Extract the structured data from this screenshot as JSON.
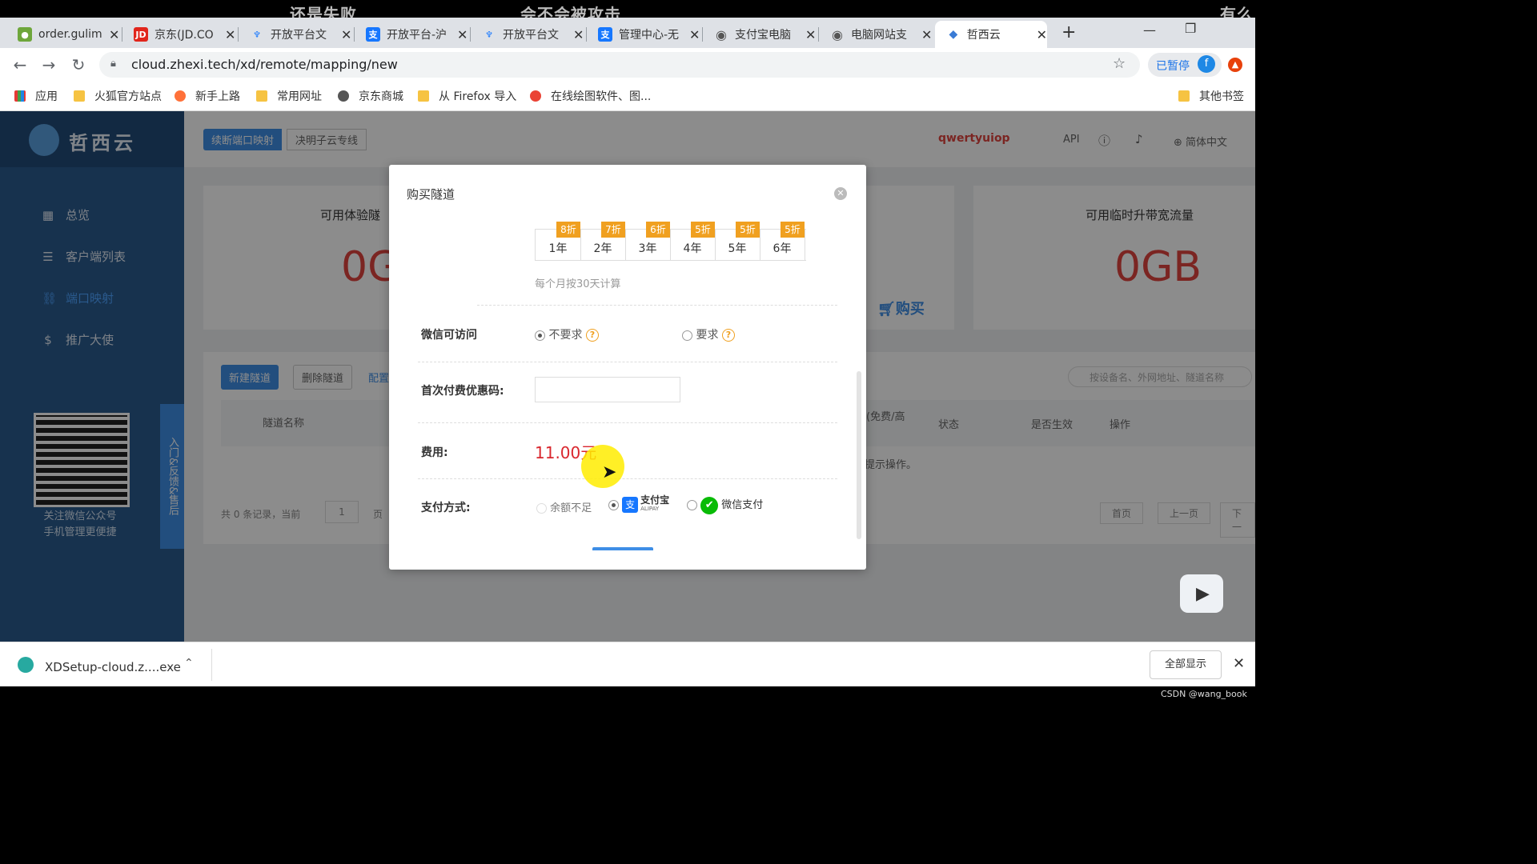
{
  "overlay": {
    "texts": [
      "还是失败",
      "会不会被攻击",
      "有么"
    ]
  },
  "tabs": [
    {
      "label": "order.gulim",
      "icon": "leaf-icon",
      "color": "#6ea63b"
    },
    {
      "label": "京东(JD.CO",
      "icon": "jd-icon",
      "color": "#e1251b"
    },
    {
      "label": "开放平台文",
      "icon": "ant-icon",
      "color": "#1677ff"
    },
    {
      "label": "开放平台-沪",
      "icon": "alipay-icon",
      "color": "#1677ff"
    },
    {
      "label": "开放平台文",
      "icon": "ant-icon",
      "color": "#1677ff"
    },
    {
      "label": "管理中心-无",
      "icon": "alipay-icon",
      "color": "#1677ff"
    },
    {
      "label": "支付宝电脑",
      "icon": "globe-icon",
      "color": "#555"
    },
    {
      "label": "电脑网站支",
      "icon": "globe-icon",
      "color": "#555"
    },
    {
      "label": "哲西云",
      "icon": "zhexi-icon",
      "color": "#3a7bd5"
    }
  ],
  "address": {
    "url": "cloud.zhexi.tech/xd/remote/mapping/new",
    "paused_label": "已暂停",
    "avatar_letter": "f"
  },
  "bookmarks": [
    {
      "label": "应用"
    },
    {
      "label": "火狐官方站点"
    },
    {
      "label": "新手上路"
    },
    {
      "label": "常用网址"
    },
    {
      "label": "京东商城"
    },
    {
      "label": "从 Firefox 导入"
    },
    {
      "label": "在线绘图软件、图..."
    }
  ],
  "bookmarks_other": "其他书签",
  "app": {
    "logo_text": "哲西云",
    "header_tabs": [
      "续断端口映射",
      "决明子云专线"
    ],
    "username": "qwertyuiop",
    "api_label": "API",
    "lang_label": "简体中文",
    "nav": [
      {
        "label": "总览",
        "icon": "grid-icon"
      },
      {
        "label": "客户端列表",
        "icon": "server-icon"
      },
      {
        "label": "端口映射",
        "icon": "link-icon"
      },
      {
        "label": "推广大使",
        "icon": "dollar-icon"
      }
    ],
    "qr_caption": [
      "关注微信公众号",
      "手机管理更便捷"
    ],
    "feedback_tab": "入门&反馈&售后",
    "card1": {
      "title": "可用体验隧",
      "value": "0G"
    },
    "card3": {
      "title": "可用临时升带宽流量",
      "value": "0GB"
    },
    "buy_label": "购买",
    "buttons": {
      "new": "新建隧道",
      "delete": "删除隧道",
      "config": "配置"
    },
    "search_placeholder": "按设备名、外网地址、隧道名称",
    "columns": [
      "隧道名称",
      "(免费/高",
      "状态",
      "是否生效",
      "操作"
    ],
    "empty_hint": "提示操作。",
    "pager": {
      "summary": "共 0 条记录，当前",
      "page": "1",
      "page_suffix": "页",
      "first": "首页",
      "prev": "上一页",
      "next": "下一"
    }
  },
  "modal": {
    "title": "购买隧道",
    "years": [
      {
        "label": "1年",
        "discount": "8折"
      },
      {
        "label": "2年",
        "discount": "7折"
      },
      {
        "label": "3年",
        "discount": "6折"
      },
      {
        "label": "4年",
        "discount": "5折"
      },
      {
        "label": "5年",
        "discount": "5折"
      },
      {
        "label": "6年",
        "discount": "5折"
      }
    ],
    "month_note": "每个月按30天计算",
    "wechat_label": "微信可访问",
    "wechat_options": [
      "不要求",
      "要求"
    ],
    "coupon_label": "首次付费优惠码:",
    "fee_label": "费用:",
    "fee_value": "11.00元",
    "pay_label": "支付方式:",
    "pay_options": {
      "balance": "余额不足",
      "alipay": "支付宝",
      "alipay_sub": "ALIPAY",
      "wechat": "微信支付"
    }
  },
  "download": {
    "file": "XDSetup-cloud.z....exe",
    "show_all": "全部显示"
  },
  "watermark": "CSDN @wang_book"
}
